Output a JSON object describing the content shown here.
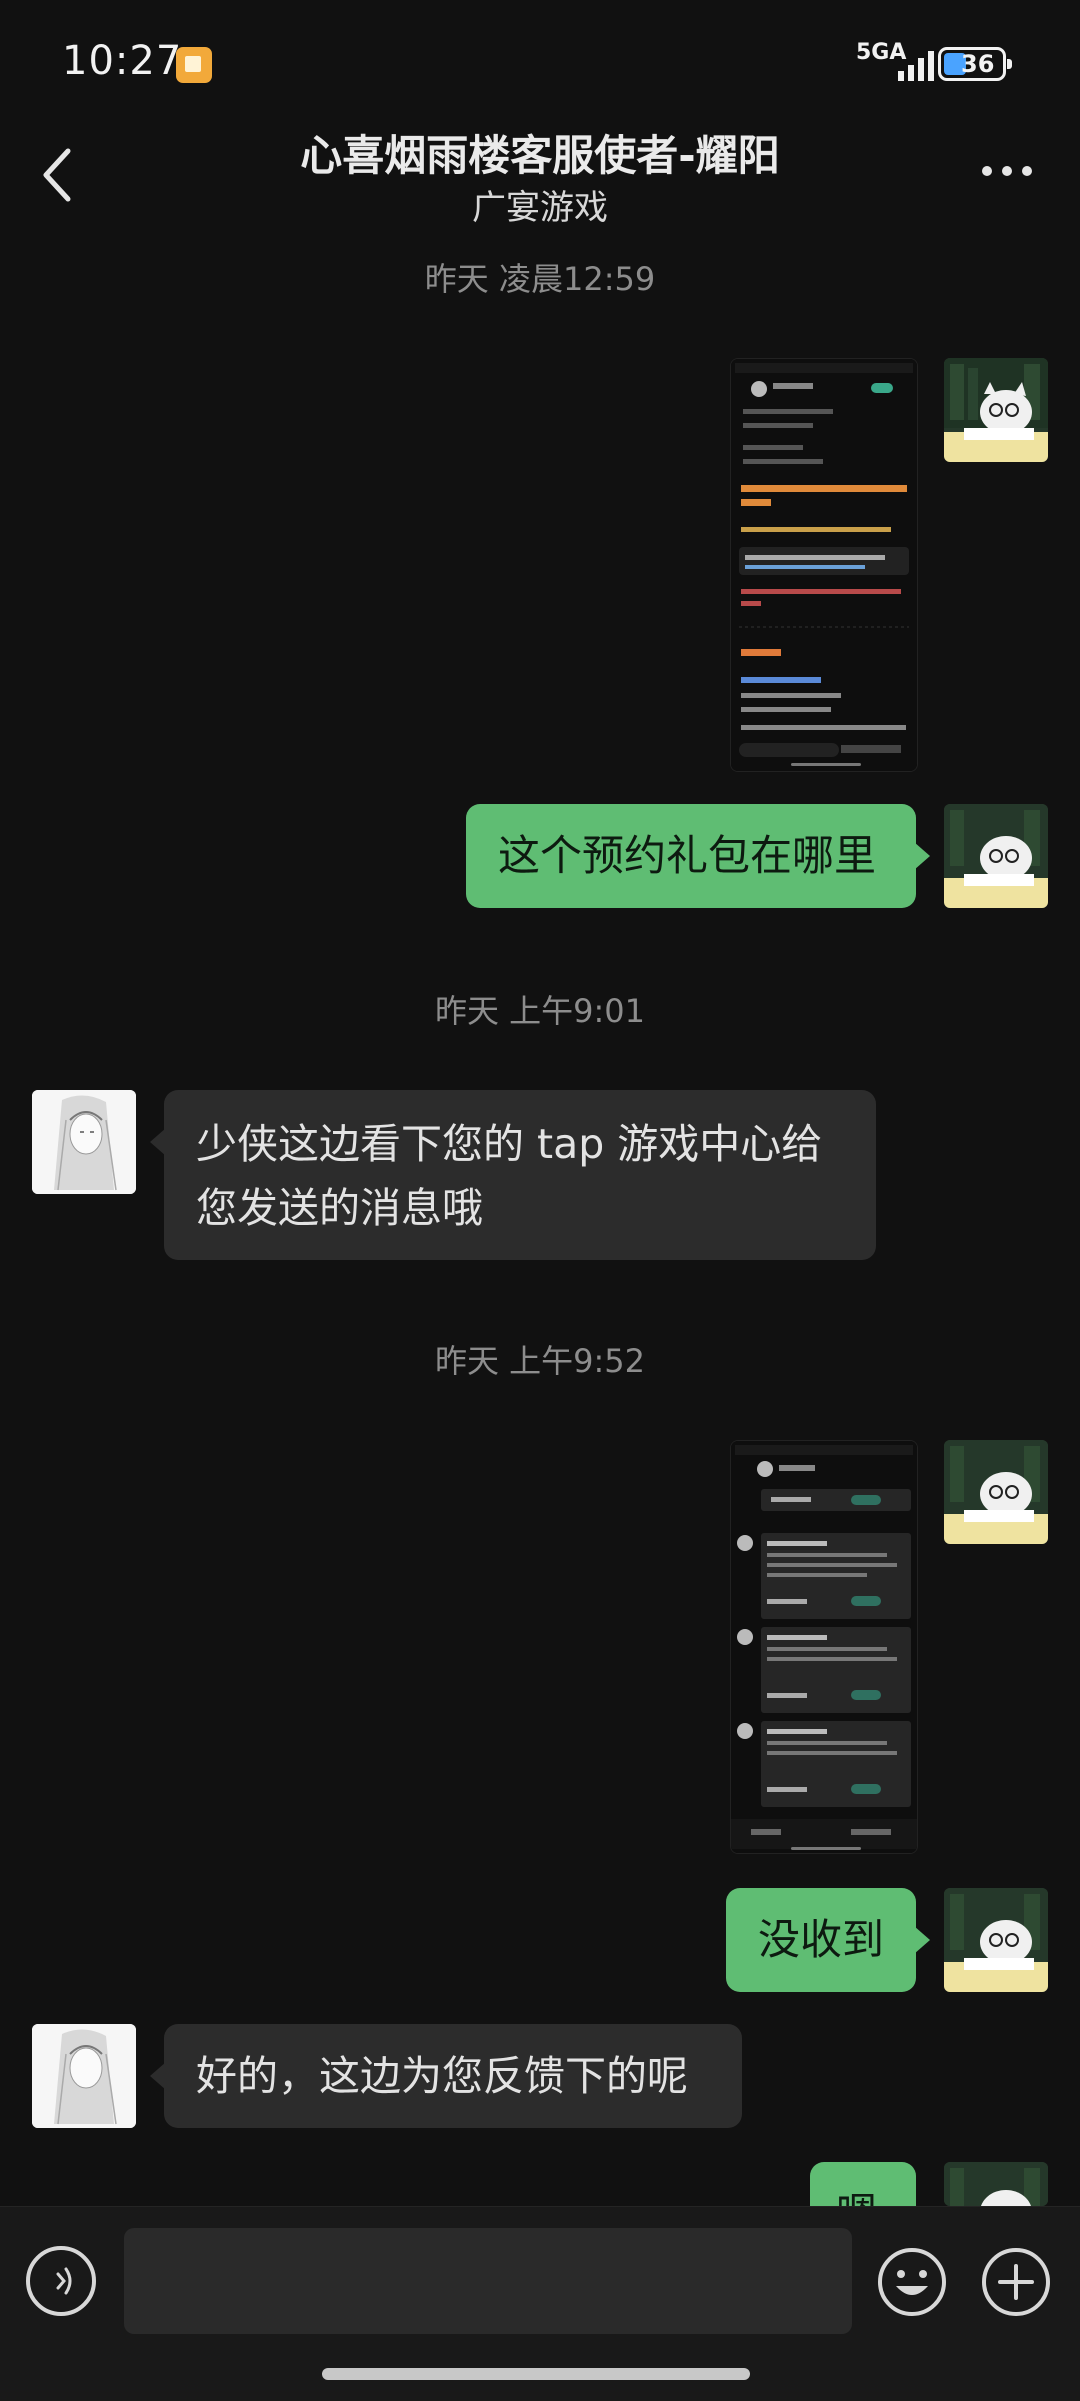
{
  "status_bar": {
    "time": "10:27",
    "network": "5GA",
    "battery_level": "36",
    "notification_icon": "app-notification-icon"
  },
  "header": {
    "title": "心喜烟雨楼客服使者-耀阳",
    "subtitle": "广宴游戏"
  },
  "messages": {
    "ts1": "昨天 凌晨12:59",
    "me_text_1": "这个预约礼包在哪里",
    "ts2": "昨天 上午9:01",
    "other_text_1_line1": "少侠这边看下您的 tap 游戏中心给",
    "other_text_1_line2": "您发送的消息哦",
    "ts3": "昨天 上午9:52",
    "me_text_2": "没收到",
    "other_text_2": "好的，这边为您反馈下的呢",
    "me_text_3_partial": "嗯"
  },
  "input": {
    "placeholder": ""
  },
  "colors": {
    "background": "#111111",
    "my_bubble": "#5fbd73",
    "other_bubble": "#2c2c2c",
    "timestamp": "#8d8d8d"
  }
}
